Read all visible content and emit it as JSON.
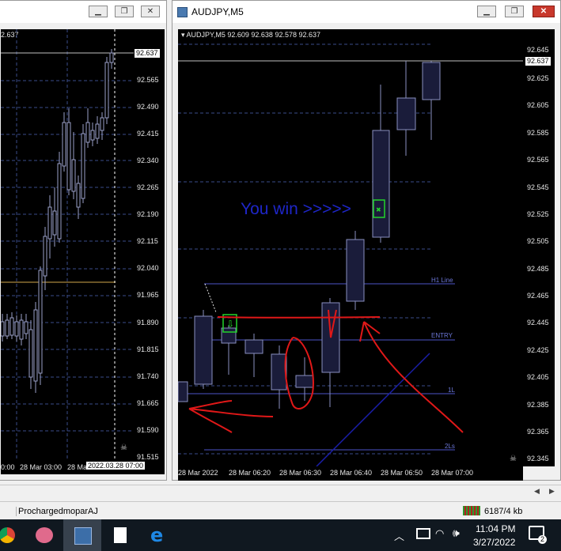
{
  "left_window": {
    "ohlc_partial": "2.637",
    "price_badge": "92.637",
    "y_labels": [
      "92.565",
      "92.490",
      "92.415",
      "92.340",
      "92.265",
      "92.190",
      "92.115",
      "92.040",
      "91.965",
      "91.890",
      "91.815",
      "91.740",
      "91.665",
      "91.590",
      "91.515"
    ],
    "x_labels": [
      "0:00",
      "28 Mar 03:00",
      "28 Ma",
      "2022.03.28 07:00"
    ]
  },
  "right_window": {
    "title": "AUDJPY,M5",
    "ohlc": "AUDJPY,M5  92.609 92.638 92.578 92.637",
    "price_badge": "92.637",
    "y_labels": [
      "92.645",
      "92.625",
      "92.605",
      "92.585",
      "92.565",
      "92.545",
      "92.525",
      "92.505",
      "92.485",
      "92.465",
      "92.445",
      "92.425",
      "92.405",
      "92.385",
      "92.365",
      "92.345"
    ],
    "x_labels": [
      "28 Mar 2022",
      "28 Mar 06:20",
      "28 Mar 06:30",
      "28 Mar 06:40",
      "28 Mar 06:50",
      "28 Mar 07:00"
    ],
    "annotation": "You win >>>>>",
    "line_labels": [
      "H1 Line",
      "ENTRY",
      "1L",
      "2Ls"
    ]
  },
  "tab_label": "ProchargedmoparAJ",
  "status": {
    "traffic": "6187/4 kb"
  },
  "taskbar": {
    "time": "11:04 PM",
    "date": "3/27/2022",
    "notification_count": "2"
  },
  "icons": [
    "minimize-icon",
    "restore-icon",
    "close-icon",
    "chrome-icon",
    "paint-icon",
    "app-icon",
    "notepad-icon",
    "edge-icon",
    "chevron-up-icon",
    "network-icon",
    "volume-icon",
    "notification-icon"
  ]
}
